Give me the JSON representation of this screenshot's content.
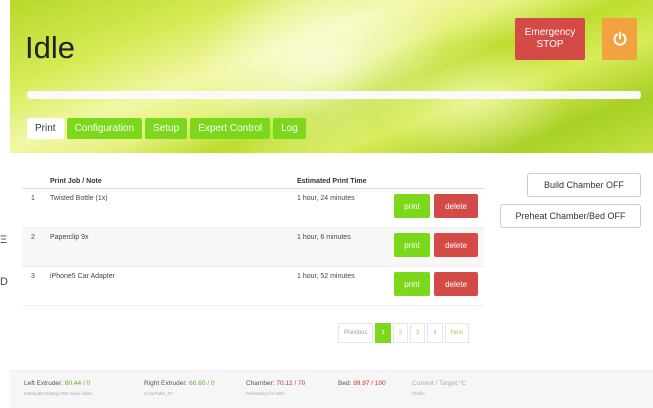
{
  "header": {
    "status": "Idle",
    "estop_label_line1": "Emergency",
    "estop_label_line2": "STOP",
    "power_icon": "power-icon",
    "progress": 0
  },
  "tabs": [
    {
      "label": "Print"
    },
    {
      "label": "Configuration"
    },
    {
      "label": "Setup"
    },
    {
      "label": "Expert Control"
    },
    {
      "label": "Log"
    }
  ],
  "table": {
    "headers": {
      "name": "Print Job / Note",
      "time": "Estimated Print Time"
    },
    "rows": [
      {
        "num": "1",
        "name": "Twisted Bottle (1x)",
        "time": "1 hour, 24 minutes"
      },
      {
        "num": "2",
        "name": "Paperclip 9x",
        "time": "1 hour, 6 minutes"
      },
      {
        "num": "3",
        "name": "iPhone5 Car Adapter",
        "time": "1 hour, 52 minutes"
      }
    ],
    "print_label": "print",
    "delete_label": "delete"
  },
  "side": {
    "build_chamber": "Build Chamber OFF",
    "preheat": "Preheat Chamber/Bed OFF"
  },
  "pagination": {
    "previous": "Previous",
    "pages": [
      "1",
      "2",
      "3",
      "4"
    ],
    "next": "Next",
    "current": "1"
  },
  "footer": {
    "left_extruder_label": "Left Extruder:",
    "left_extruder_value": "60.44 / 0",
    "left_extruder_sub": "KSMegBAG(Meg ABS snow white",
    "right_extruder_label": "Right Extruder:",
    "right_extruder_value": "60.60 / 0",
    "right_extruder_sub": "ColorFabb_XT",
    "chamber_label": "Chamber:",
    "chamber_value": "70.12 / 70",
    "chamber_sub": "Preheating for ABS",
    "bed_label": "Bed:",
    "bed_value": "99.97 / 100",
    "current_target": "Current / Target °C",
    "profile": "Profile"
  },
  "colors": {
    "accent": "#7bd81a",
    "danger": "#d44a47",
    "warning": "#f2a340"
  }
}
